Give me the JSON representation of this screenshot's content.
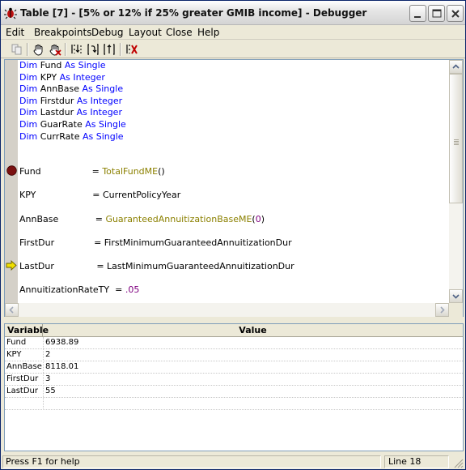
{
  "window": {
    "title": "Table [7] - [5% or 12% if 25% greater GMIB income] - Debugger"
  },
  "menu": [
    {
      "label": "Edit"
    },
    {
      "label": "Breakpoints"
    },
    {
      "label": "Debug"
    },
    {
      "label": "Layout"
    },
    {
      "label": "Close"
    },
    {
      "label": "Help"
    }
  ],
  "toolbar": {
    "icons": [
      "copy-icon",
      "hand-icon",
      "hand-remove-icon",
      "step-into-icon",
      "step-over-icon",
      "step-out-icon",
      "stop-debug-icon"
    ]
  },
  "code": {
    "lines": [
      {
        "parts": [
          {
            "t": "Dim ",
            "c": "kw"
          },
          {
            "t": "Fund ",
            "c": ""
          },
          {
            "t": "As Single",
            "c": "kw"
          }
        ]
      },
      {
        "parts": [
          {
            "t": "Dim ",
            "c": "kw"
          },
          {
            "t": "KPY ",
            "c": ""
          },
          {
            "t": "As Integer",
            "c": "kw"
          }
        ]
      },
      {
        "parts": [
          {
            "t": "Dim ",
            "c": "kw"
          },
          {
            "t": "AnnBase ",
            "c": ""
          },
          {
            "t": "As Single",
            "c": "kw"
          }
        ]
      },
      {
        "parts": [
          {
            "t": "Dim ",
            "c": "kw"
          },
          {
            "t": "Firstdur ",
            "c": ""
          },
          {
            "t": "As Integer",
            "c": "kw"
          }
        ]
      },
      {
        "parts": [
          {
            "t": "Dim ",
            "c": "kw"
          },
          {
            "t": "Lastdur ",
            "c": ""
          },
          {
            "t": "As Integer",
            "c": "kw"
          }
        ]
      },
      {
        "parts": [
          {
            "t": "Dim ",
            "c": "kw"
          },
          {
            "t": "GuarRate ",
            "c": ""
          },
          {
            "t": "As Single",
            "c": "kw"
          }
        ]
      },
      {
        "parts": [
          {
            "t": "Dim ",
            "c": "kw"
          },
          {
            "t": "CurrRate ",
            "c": ""
          },
          {
            "t": "As Single",
            "c": "kw"
          }
        ]
      },
      {
        "parts": [
          {
            "t": "Fund                  = ",
            "c": ""
          },
          {
            "t": "TotalFundME",
            "c": "fn"
          },
          {
            "t": "()",
            "c": ""
          }
        ],
        "marker": "breakpoint"
      },
      {
        "parts": [
          {
            "t": "KPY                    = CurrentPolicyYear",
            "c": ""
          }
        ]
      },
      {
        "parts": [
          {
            "t": "AnnBase             = ",
            "c": ""
          },
          {
            "t": "GuaranteedAnnuitizationBaseME",
            "c": "fn"
          },
          {
            "t": "(",
            "c": ""
          },
          {
            "t": "0",
            "c": "num"
          },
          {
            "t": ")",
            "c": ""
          }
        ]
      },
      {
        "parts": [
          {
            "t": "FirstDur              = FirstMinimumGuaranteedAnnuitizationDur",
            "c": ""
          }
        ]
      },
      {
        "parts": [
          {
            "t": "LastDur               = LastMinimumGuaranteedAnnuitizationDur",
            "c": ""
          }
        ],
        "marker": "current"
      },
      {
        "parts": [
          {
            "t": "AnnuitizationRateTY  = ",
            "c": ""
          },
          {
            "t": ".05",
            "c": "num"
          }
        ]
      }
    ]
  },
  "variables": {
    "headers": {
      "variable": "Variable",
      "value": "Value"
    },
    "rows": [
      {
        "name": "Fund",
        "value": "6938.89"
      },
      {
        "name": "KPY",
        "value": "2"
      },
      {
        "name": "AnnBase",
        "value": "8118.01"
      },
      {
        "name": "FirstDur",
        "value": "3"
      },
      {
        "name": "LastDur",
        "value": "55"
      },
      {
        "name": "",
        "value": ""
      }
    ]
  },
  "status": {
    "message": "Press F1 for help",
    "position": "Line 18"
  },
  "colors": {
    "keyword": "#0000ff",
    "function": "#8b8000",
    "number": "#800080",
    "breakpoint": "#7a1010",
    "current_line_arrow": "#f0e000"
  }
}
